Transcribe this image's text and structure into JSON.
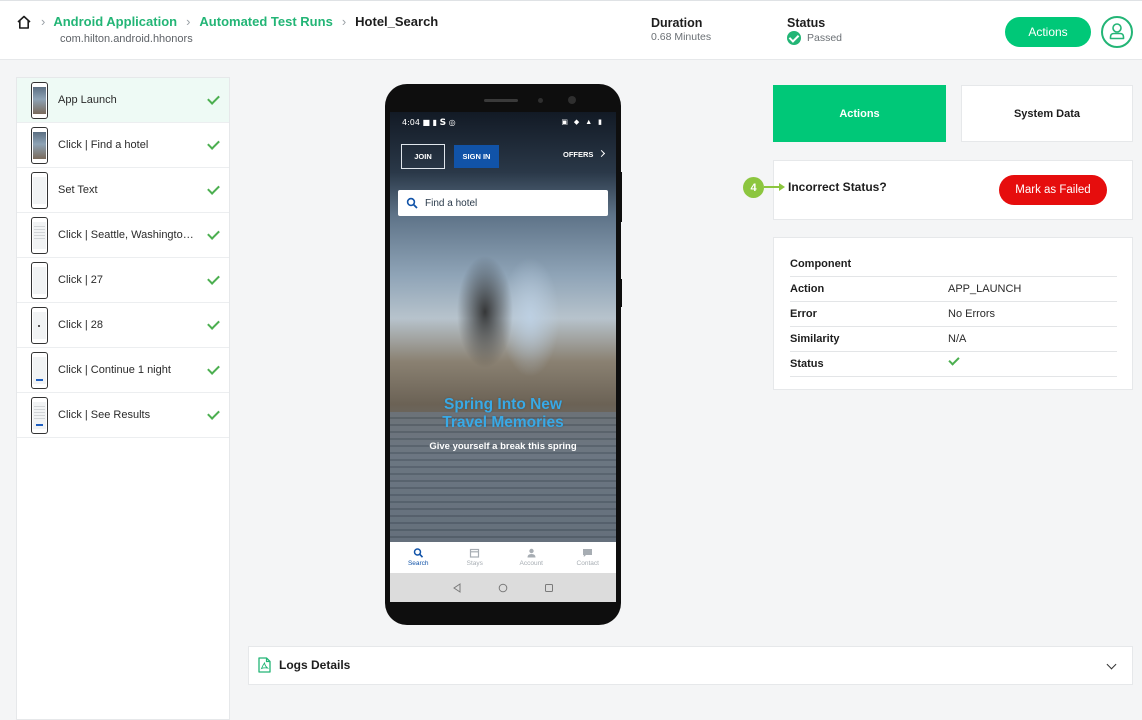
{
  "header": {
    "breadcrumbs": [
      "Android Application",
      "Automated Test Runs",
      "Hotel_Search"
    ],
    "subtitle": "com.hilton.android.hhonors",
    "duration_label": "Duration",
    "duration_value": "0.68 Minutes",
    "status_label": "Status",
    "status_value": "Passed",
    "actions_label": "Actions"
  },
  "steps": [
    {
      "label": "App Launch",
      "thumb": "photo",
      "active": true
    },
    {
      "label": "Click | Find a hotel",
      "thumb": "photo"
    },
    {
      "label": "Set Text",
      "thumb": "blank"
    },
    {
      "label": "Click | Seattle, Washington, ...",
      "thumb": "lines"
    },
    {
      "label": "Click | 27",
      "thumb": "blank"
    },
    {
      "label": "Click | 28",
      "thumb": "dot"
    },
    {
      "label": "Click | Continue 1 night",
      "thumb": "bar"
    },
    {
      "label": "Click | See Results",
      "thumb": "lines-bar"
    }
  ],
  "phone": {
    "time": "4:04",
    "join_label": "JOIN",
    "signin_label": "SIGN IN",
    "offers_label": "OFFERS",
    "search_placeholder": "Find a hotel",
    "promo_line1": "Spring Into New",
    "promo_line2": "Travel Memories",
    "promo_sub": "Give yourself a break this spring",
    "tabs": [
      {
        "label": "Search",
        "icon": "search-icon"
      },
      {
        "label": "Stays",
        "icon": "calendar-icon"
      },
      {
        "label": "Account",
        "icon": "person-icon"
      },
      {
        "label": "Contact",
        "icon": "chat-icon"
      }
    ]
  },
  "panel": {
    "actions_tab": "Actions",
    "system_tab": "System Data",
    "badge_number": "4",
    "incorrect_label": "Incorrect Status?",
    "mark_failed_label": "Mark as Failed",
    "info_rows": [
      {
        "key": "Component",
        "value": ""
      },
      {
        "key": "Action",
        "value": "APP_LAUNCH"
      },
      {
        "key": "Error",
        "value": "No Errors"
      },
      {
        "key": "Similarity",
        "value": "N/A"
      },
      {
        "key": "Status",
        "value": ""
      }
    ]
  },
  "logs": {
    "title": "Logs Details"
  },
  "colors": {
    "accent": "#00c878",
    "link": "#23b576",
    "danger": "#e60d0d",
    "badge": "#8cc63f",
    "check": "#4caf50"
  }
}
